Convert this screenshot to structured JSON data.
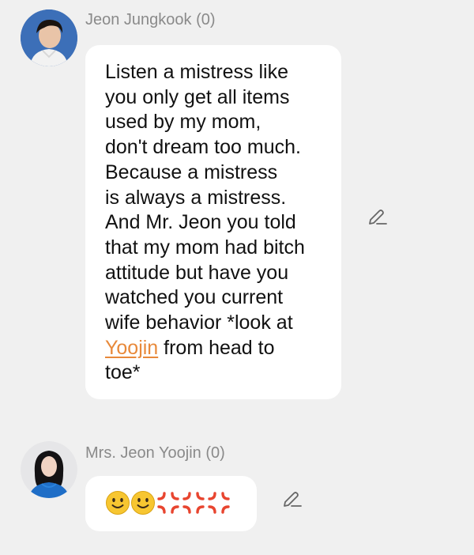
{
  "messages": [
    {
      "sender": "Jeon Jungkook (0)",
      "text_before": "Listen a mistress like\nyou only get all items\nused by my mom,\ndon't dream too much.\nBecause a mistress\nis always a mistress.\nAnd Mr. Jeon you told\nthat my mom had bitch\nattitude but have you\nwatched you current\nwife behavior *look at\n",
      "mention": "Yoojin",
      "text_after": " from head to\ntoe*",
      "avatar_icon": "male-profile-avatar",
      "edit_icon": "pencil-icon"
    },
    {
      "sender": "Mrs. Jeon Yoojin (0)",
      "emojis": [
        "slightly-smiling-face",
        "slightly-smiling-face",
        "anger-symbol",
        "anger-symbol",
        "anger-symbol"
      ],
      "avatar_icon": "female-profile-avatar",
      "edit_icon": "pencil-icon"
    }
  ],
  "colors": {
    "background": "#f0f0f0",
    "bubble": "#ffffff",
    "mention": "#e8893a",
    "sender": "#8a8a8a",
    "anger": "#e8452f",
    "smiley": "#f7c631"
  }
}
